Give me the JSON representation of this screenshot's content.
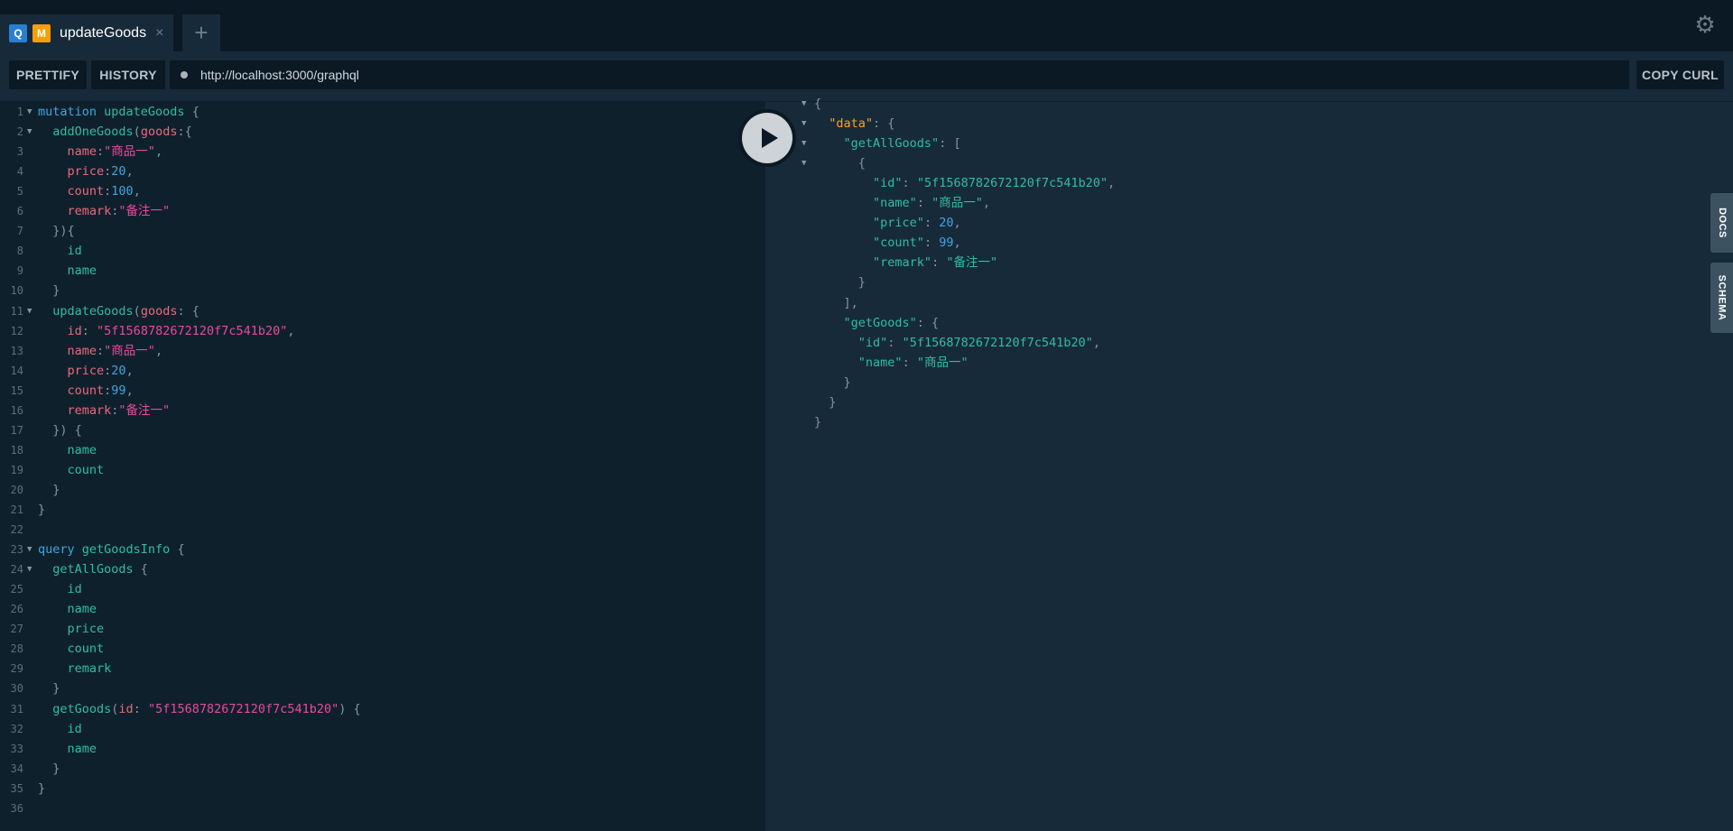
{
  "tab": {
    "q_badge": "Q",
    "m_badge": "M",
    "title": "updateGoods",
    "close": "×",
    "add": "+"
  },
  "toolbar": {
    "prettify": "PRETTIFY",
    "history": "HISTORY",
    "url": "http://localhost:3000/graphql",
    "copy_curl": "COPY CURL"
  },
  "sidebar": {
    "docs": "DOCS",
    "schema": "SCHEMA"
  },
  "icons": {
    "settings": "gear-icon",
    "execute": "play-icon"
  },
  "colors": {
    "keyword": "#3fa6e0",
    "field": "#2fbf9e",
    "argument": "#e96a7c",
    "string": "#e84a9c",
    "json_key_root": "#f7a227"
  },
  "query_lines": [
    [
      [
        "kw",
        "mutation "
      ],
      [
        "op",
        "updateGoods"
      ],
      [
        "pun",
        " {"
      ]
    ],
    [
      [
        "fld",
        "  addOneGoods"
      ],
      [
        "pun",
        "("
      ],
      [
        "arg",
        "goods"
      ],
      [
        "pun",
        ":{"
      ]
    ],
    [
      [
        "arg",
        "    name"
      ],
      [
        "pun",
        ":"
      ],
      [
        "str",
        "\"商品一\""
      ],
      [
        "pun",
        ","
      ]
    ],
    [
      [
        "arg",
        "    price"
      ],
      [
        "pun",
        ":"
      ],
      [
        "num",
        "20"
      ],
      [
        "pun",
        ","
      ]
    ],
    [
      [
        "arg",
        "    count"
      ],
      [
        "pun",
        ":"
      ],
      [
        "num",
        "100"
      ],
      [
        "pun",
        ","
      ]
    ],
    [
      [
        "arg",
        "    remark"
      ],
      [
        "pun",
        ":"
      ],
      [
        "str",
        "\"备注一\""
      ]
    ],
    [
      [
        "pun",
        "  }){"
      ]
    ],
    [
      [
        "fld",
        "    id"
      ]
    ],
    [
      [
        "fld",
        "    name"
      ]
    ],
    [
      [
        "pun",
        "  }"
      ]
    ],
    [
      [
        "fld",
        "  updateGoods"
      ],
      [
        "pun",
        "("
      ],
      [
        "arg",
        "goods"
      ],
      [
        "pun",
        ": {"
      ]
    ],
    [
      [
        "arg",
        "    id"
      ],
      [
        "pun",
        ": "
      ],
      [
        "str",
        "\"5f1568782672120f7c541b20\""
      ],
      [
        "pun",
        ","
      ]
    ],
    [
      [
        "arg",
        "    name"
      ],
      [
        "pun",
        ":"
      ],
      [
        "str",
        "\"商品一\""
      ],
      [
        "pun",
        ","
      ]
    ],
    [
      [
        "arg",
        "    price"
      ],
      [
        "pun",
        ":"
      ],
      [
        "num",
        "20"
      ],
      [
        "pun",
        ","
      ]
    ],
    [
      [
        "arg",
        "    count"
      ],
      [
        "pun",
        ":"
      ],
      [
        "num",
        "99"
      ],
      [
        "pun",
        ","
      ]
    ],
    [
      [
        "arg",
        "    remark"
      ],
      [
        "pun",
        ":"
      ],
      [
        "str",
        "\"备注一\""
      ]
    ],
    [
      [
        "pun",
        "  }) {"
      ]
    ],
    [
      [
        "fld",
        "    name"
      ]
    ],
    [
      [
        "fld",
        "    count"
      ]
    ],
    [
      [
        "pun",
        "  }"
      ]
    ],
    [
      [
        "pun",
        "}"
      ]
    ],
    [],
    [
      [
        "kw",
        "query "
      ],
      [
        "op",
        "getGoodsInfo"
      ],
      [
        "pun",
        " {"
      ]
    ],
    [
      [
        "fld",
        "  getAllGoods"
      ],
      [
        "pun",
        " {"
      ]
    ],
    [
      [
        "fld",
        "    id"
      ]
    ],
    [
      [
        "fld",
        "    name"
      ]
    ],
    [
      [
        "fld",
        "    price"
      ]
    ],
    [
      [
        "fld",
        "    count"
      ]
    ],
    [
      [
        "fld",
        "    remark"
      ]
    ],
    [
      [
        "pun",
        "  }"
      ]
    ],
    [
      [
        "fld",
        "  getGoods"
      ],
      [
        "pun",
        "("
      ],
      [
        "arg",
        "id"
      ],
      [
        "pun",
        ": "
      ],
      [
        "str",
        "\"5f1568782672120f7c541b20\""
      ],
      [
        "pun",
        ") {"
      ]
    ],
    [
      [
        "fld",
        "    id"
      ]
    ],
    [
      [
        "fld",
        "    name"
      ]
    ],
    [
      [
        "pun",
        "  }"
      ]
    ],
    [
      [
        "pun",
        "}"
      ]
    ],
    []
  ],
  "query_folds": [
    1,
    2,
    11,
    23,
    24
  ],
  "result_lines": [
    [
      [
        "pun",
        "{"
      ]
    ],
    [
      [
        "pun",
        "  "
      ],
      [
        "jkeyorange",
        "\"data\""
      ],
      [
        "pun",
        ": {"
      ]
    ],
    [
      [
        "pun",
        "    "
      ],
      [
        "jkey",
        "\"getAllGoods\""
      ],
      [
        "pun",
        ": ["
      ]
    ],
    [
      [
        "pun",
        "      {"
      ]
    ],
    [
      [
        "pun",
        "        "
      ],
      [
        "jkey",
        "\"id\""
      ],
      [
        "pun",
        ": "
      ],
      [
        "jstr",
        "\"5f1568782672120f7c541b20\""
      ],
      [
        "pun",
        ","
      ]
    ],
    [
      [
        "pun",
        "        "
      ],
      [
        "jkey",
        "\"name\""
      ],
      [
        "pun",
        ": "
      ],
      [
        "jstr",
        "\"商品一\""
      ],
      [
        "pun",
        ","
      ]
    ],
    [
      [
        "pun",
        "        "
      ],
      [
        "jkey",
        "\"price\""
      ],
      [
        "pun",
        ": "
      ],
      [
        "jnum",
        "20"
      ],
      [
        "pun",
        ","
      ]
    ],
    [
      [
        "pun",
        "        "
      ],
      [
        "jkey",
        "\"count\""
      ],
      [
        "pun",
        ": "
      ],
      [
        "jnum",
        "99"
      ],
      [
        "pun",
        ","
      ]
    ],
    [
      [
        "pun",
        "        "
      ],
      [
        "jkey",
        "\"remark\""
      ],
      [
        "pun",
        ": "
      ],
      [
        "jstr",
        "\"备注一\""
      ]
    ],
    [
      [
        "pun",
        "      }"
      ]
    ],
    [
      [
        "pun",
        "    ],"
      ]
    ],
    [
      [
        "pun",
        "    "
      ],
      [
        "jkey",
        "\"getGoods\""
      ],
      [
        "pun",
        ": {"
      ]
    ],
    [
      [
        "pun",
        "      "
      ],
      [
        "jkey",
        "\"id\""
      ],
      [
        "pun",
        ": "
      ],
      [
        "jstr",
        "\"5f1568782672120f7c541b20\""
      ],
      [
        "pun",
        ","
      ]
    ],
    [
      [
        "pun",
        "      "
      ],
      [
        "jkey",
        "\"name\""
      ],
      [
        "pun",
        ": "
      ],
      [
        "jstr",
        "\"商品一\""
      ]
    ],
    [
      [
        "pun",
        "    }"
      ]
    ],
    [
      [
        "pun",
        "  }"
      ]
    ],
    [
      [
        "pun",
        "}"
      ]
    ]
  ],
  "result_folds": [
    1,
    2,
    3,
    4
  ]
}
